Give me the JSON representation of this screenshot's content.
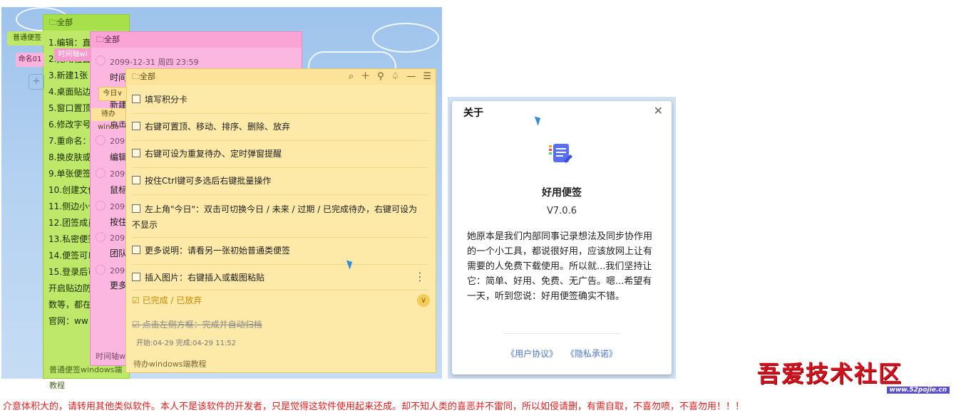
{
  "green_note": {
    "header": "全部",
    "lines": [
      "1.编辑：直",
      "2.拖动位置",
      "3.新建1张",
      "4.桌面贴边",
      "5.窗口置顶",
      "6.修改字号",
      "7.重命名：",
      "8.换皮肤或",
      "9.单张便签",
      "10.创建文件",
      "11.侧边小卡",
      "12.团签成员",
      "13.私密便签",
      "14.便签可以",
      "15.登录后可",
      "开启贴边防",
      "数等，都在",
      "官网：ww"
    ],
    "footer": "普通便签windows端教程"
  },
  "side_tags": {
    "green": "普通便签",
    "pink": "命名01",
    "plus": "+"
  },
  "pink_note": {
    "header": "全部",
    "tag": "时间轴wi",
    "date": "2099-12-31 周四 23:59",
    "items": [
      "时间",
      "新建",
      "点击",
      "编辑",
      "鼠标",
      "按住",
      "团队",
      "更多"
    ],
    "times": [
      "2099",
      "2099",
      "2099",
      "2099",
      "2099"
    ],
    "footer": "时间轴wi"
  },
  "yellow_note": {
    "header": "全部",
    "today_tag": "今日∨",
    "todo_tag": "待办windo",
    "todos": [
      "填写积分卡",
      "右键可置顶、移动、排序、删除、放弃",
      "右键可设为重复待办、定时弹窗提醒",
      "按住Ctrl键可多选后右键批量操作",
      "左上角\"今日\"：双击可切换今日 / 未来 / 过期 / 已完成待办，右键可设为",
      "不显示",
      "更多说明：请看另一张初始普通类便签",
      "插入图片：右键插入或截图粘贴"
    ],
    "done_header": "已完成 / 已放弃",
    "done_item": "点击左侧方框：完成并自动归档",
    "done_meta": "开始:04-29 完成:04-29 11:52",
    "footer": "待办windows端教程"
  },
  "about": {
    "title": "关于",
    "app_name": "好用便签",
    "version": "V7.0.6",
    "description": "她原本是我们内部同事记录想法及同步协作用的一个小工具，都说很好用，应该放网上让有需要的人免费下载使用。所以就...我们坚持让它：简单、好用、免费、无广告。嗯...希望有一天，听到您说：好用便签确实不错。",
    "link_agreement": "《用户协议》",
    "link_privacy": "《隐私承诺》"
  },
  "watermark": {
    "name": "吾爱技术社区",
    "url": "www.52pojie.cn"
  },
  "bottom_note": "介意体积大的，请转用其他类似软件。本人不是该软件的开发者，只是觉得这软件使用起来还成。却不知人类的喜恶并不雷同，所以如侵请删，有需自取，不喜勿喷，不喜勿用！！！",
  "colors": {
    "green": "#bde86a",
    "pink": "#fbb7e0",
    "yellow": "#fde9a8",
    "accent": "#4a76c4",
    "warn": "#e02020"
  }
}
